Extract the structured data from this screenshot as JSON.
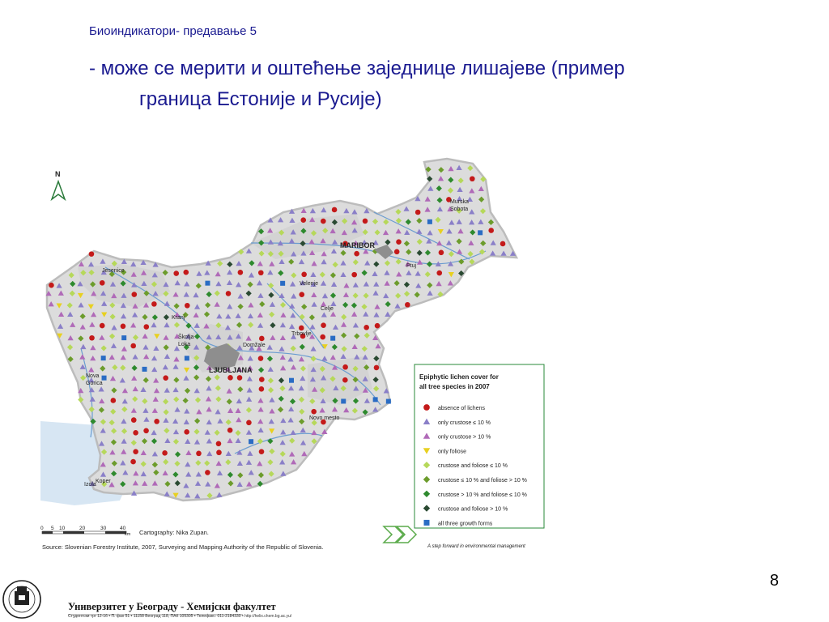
{
  "slide": {
    "subtitle": "Биоиндикатори- предавање 5",
    "bullet_line1": "- може се мерити и оштећење заједнице лишајеве (пример",
    "bullet_line2": "граница Естоније и Русије)",
    "page_number": "8"
  },
  "map": {
    "north_label": "N",
    "cities": [
      "Murska Sobota",
      "MARIBOR",
      "Ptuj",
      "Jesenice",
      "Velenje",
      "Celje",
      "Kranj",
      "Škofja Loka",
      "Domžale",
      "Trbovlje",
      "LJUBLJANA",
      "Nova Gorica",
      "Novo mesto",
      "Izola",
      "Koper"
    ],
    "scale_ticks": [
      "0",
      "5",
      "10",
      "20",
      "30",
      "40"
    ],
    "scale_unit": "km",
    "cartography": "Cartography: Nika Zupan.",
    "source": "Source: Slovenian Forestry Institute, 2007, Surveying and Mapping Authority of the Republic of Slovenia.",
    "legend": {
      "title_line1": "Epiphytic lichen cover for",
      "title_line2": "all tree species in 2007",
      "items": [
        {
          "label": "absence of lichens",
          "color": "#c41a1a",
          "symbol": "circle"
        },
        {
          "label": "only crustose ≤ 10 %",
          "color": "#8a7fc8",
          "symbol": "triangle"
        },
        {
          "label": "only crustose > 10 %",
          "color": "#b06ab8",
          "symbol": "triangle"
        },
        {
          "label": "only foliose",
          "color": "#e8d020",
          "symbol": "triangle-down"
        },
        {
          "label": "crustose and foliose ≤ 10 %",
          "color": "#b6d85a",
          "symbol": "diamond"
        },
        {
          "label": "crustose ≤ 10 % and foliose > 10 %",
          "color": "#6c9c2c",
          "symbol": "diamond"
        },
        {
          "label": "crustose > 10 % and foliose ≤ 10 %",
          "color": "#2e8a2e",
          "symbol": "diamond"
        },
        {
          "label": "crustose and foliose > 10 %",
          "color": "#2a4a32",
          "symbol": "diamond"
        },
        {
          "label": "all three growth forms",
          "color": "#2a6cc4",
          "symbol": "square"
        }
      ],
      "tagline": "A step forward in environmental management"
    }
  },
  "footer": {
    "university": "Универзитет у Београду - Хемијски факултет",
    "contact": "Студентски трг 12-16 • П. фах 51 • 11158 Београд 118, ПАК 105305 • Телефакс: 011-2184330 • http://helix.chem.bg.ac.yu/",
    "seal_text": "Универзитет у Београду - Хемијски факултет"
  }
}
